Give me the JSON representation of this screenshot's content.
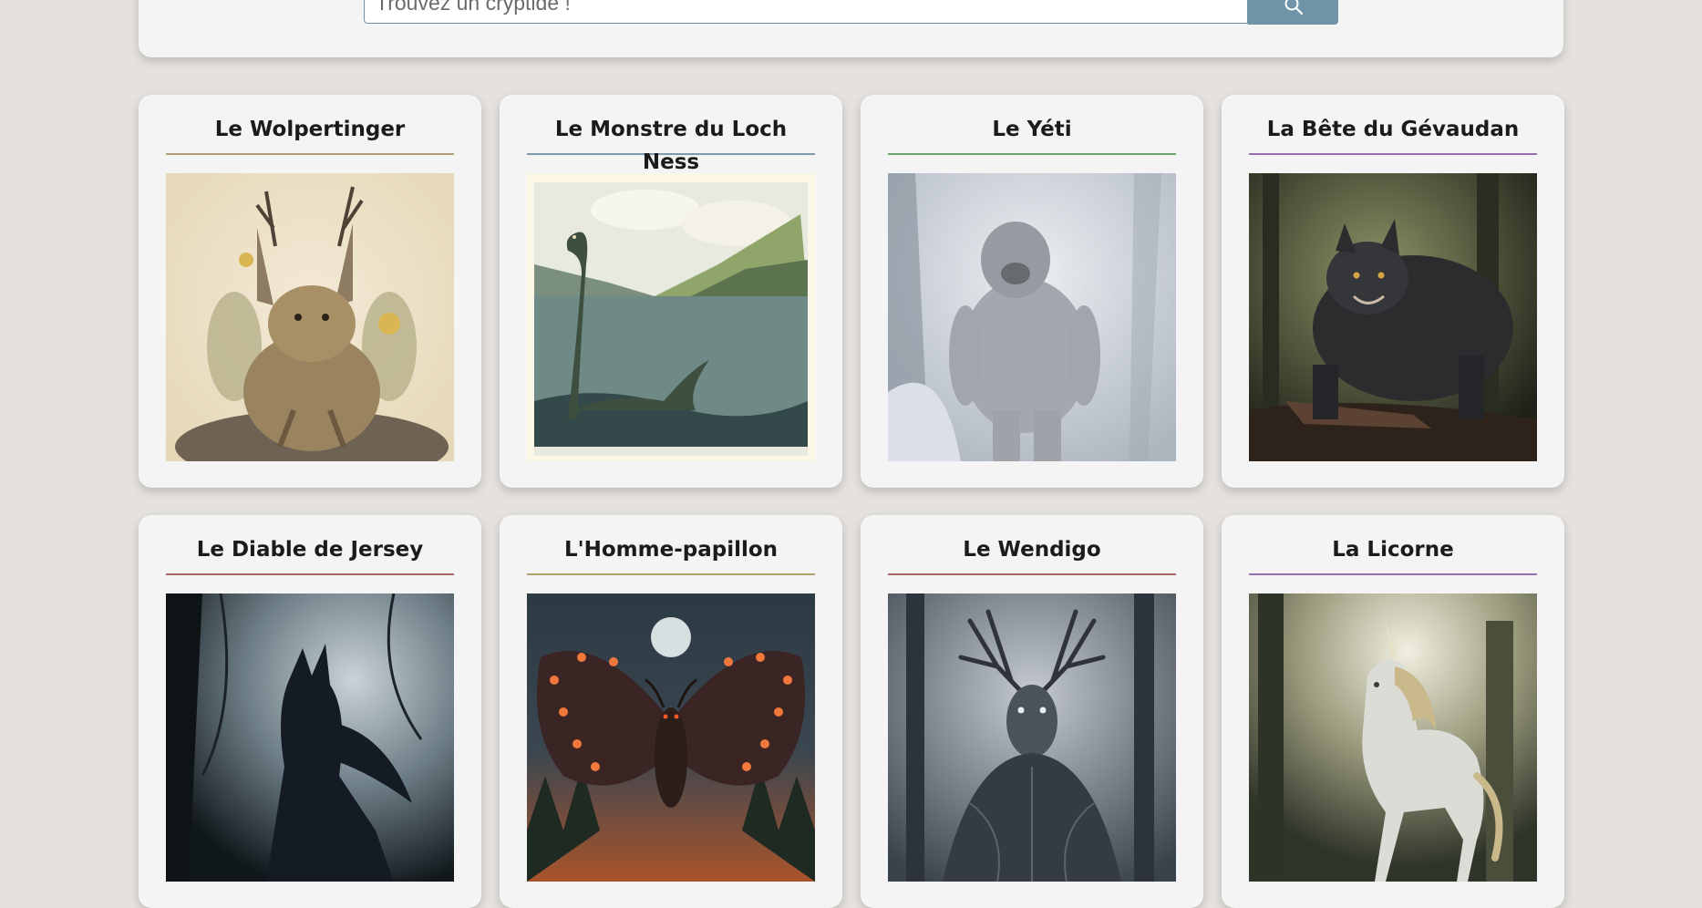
{
  "search": {
    "placeholder": "Trouvez un cryptide !",
    "button_icon": "search-icon"
  },
  "cards": [
    {
      "title": "Le Wolpertinger",
      "accent": "#b09a78",
      "image": "wolpertinger-illustration"
    },
    {
      "title": "Le Monstre du Loch Ness",
      "accent": "#7d99ab",
      "image": "loch-ness-illustration"
    },
    {
      "title": "Le Yéti",
      "accent": "#6aa06a",
      "image": "yeti-illustration"
    },
    {
      "title": "La Bête du Gévaudan",
      "accent": "#9a6fb0",
      "image": "gevaudan-beast-illustration"
    },
    {
      "title": "Le Diable de Jersey",
      "accent": "#a7675f",
      "image": "jersey-devil-illustration"
    },
    {
      "title": "L'Homme-papillon",
      "accent": "#b3a06a",
      "image": "mothman-illustration"
    },
    {
      "title": "Le Wendigo",
      "accent": "#a7675f",
      "image": "wendigo-illustration"
    },
    {
      "title": "La Licorne",
      "accent": "#9a6fb0",
      "image": "unicorn-illustration"
    }
  ],
  "colors": {
    "background": "#e4e1de",
    "panel": "#f4f4f4",
    "search_accent": "#6f93a7"
  }
}
